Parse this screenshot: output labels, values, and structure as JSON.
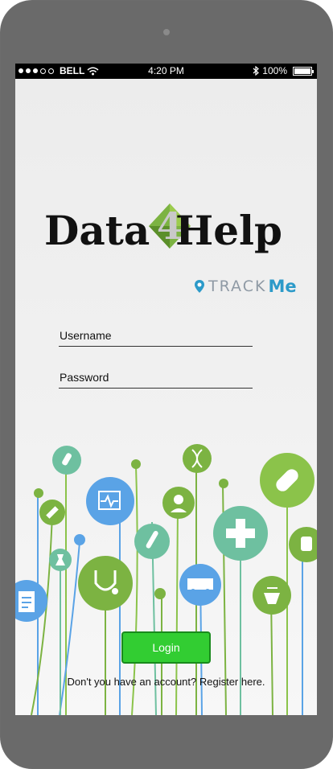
{
  "status_bar": {
    "carrier": "BELL",
    "time": "4:20 PM",
    "battery": "100%",
    "signal_bars_filled": 3,
    "signal_bars_total": 5
  },
  "logo": {
    "part_left": "Data",
    "part_number": "4",
    "part_right": "Help"
  },
  "brand": {
    "track": "TRACK",
    "me": "Me"
  },
  "form": {
    "username_label": "Username",
    "password_label": "Password"
  },
  "login_button": "Login",
  "register_text": "Don't you have an account? Register here.",
  "colors": {
    "accent_green": "#32cd32",
    "teal": "#2c9ac9",
    "icon_green": "#7cb342",
    "icon_blue": "#5aa3e6",
    "icon_mint": "#6ec0a0"
  },
  "icons": [
    "test-tube-icon",
    "dna-icon",
    "heartbeat-monitor-icon",
    "pill-icon",
    "syringe-icon",
    "nurse-icon",
    "medical-cross-icon",
    "thermometer-icon",
    "flask-icon",
    "clipboard-icon",
    "stethoscope-icon",
    "ambulance-icon",
    "pharmacy-icon",
    "iv-bag-icon"
  ]
}
